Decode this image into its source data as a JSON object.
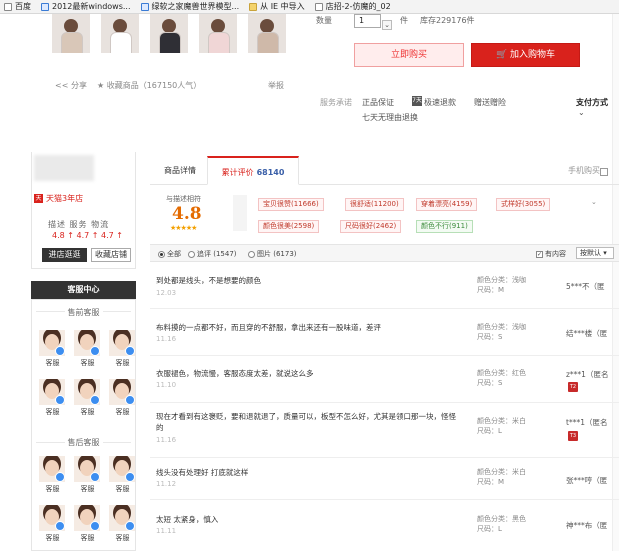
{
  "bookmarks": [
    {
      "label": "百度",
      "icon": "page-icon"
    },
    {
      "label": "2012最新windows...",
      "icon": "ie-icon"
    },
    {
      "label": "绿软之家魔兽世界模型...",
      "icon": "ie-icon"
    },
    {
      "label": "从 IE 中导入",
      "icon": "folder-icon"
    },
    {
      "label": "店招-2-仿魔的_02",
      "icon": "page-icon"
    }
  ],
  "purchase": {
    "qty_label": "数量",
    "qty_value": "1",
    "qty_unit": "件",
    "stock": "库存229176件",
    "buy_now": "立即购买",
    "add_to_cart": "加入购物车"
  },
  "actions": {
    "share": "分享",
    "favorite": "收藏商品（167150人气）",
    "report": "举报"
  },
  "services": {
    "label": "服务承诺",
    "item1": "正品保证",
    "item2_icon_text": "7天",
    "item2": "极速退款",
    "item3": "赠送赠险",
    "item4": "七天无理由退换",
    "payment_label": "支付方式",
    "payment_chevron": "⌄"
  },
  "shop": {
    "level_icon": "天",
    "level": "天猫3年店",
    "dsr_head": "描述 服务 物流",
    "dsr_values": "4.8 ↑   4.7 ↑   4.7 ↑",
    "enter_shop": "进店逛逛",
    "save_shop": "收藏店铺"
  },
  "customer_service": {
    "title": "客服中心",
    "presale_title": "售前客服",
    "aftersale_title": "售后客服",
    "agent_label": "客服"
  },
  "tabs": {
    "detail": "商品详情",
    "reviews": "累计评价",
    "reviews_count": "68140",
    "mobile": "手机购买"
  },
  "rating": {
    "label": "与描述相符",
    "score": "4.8",
    "stars": "★★★★★",
    "star_rating": 4.8
  },
  "tags": [
    {
      "text": "宝贝很赞(11666)",
      "type": "pos"
    },
    {
      "text": "很舒适(11200)",
      "type": "pos"
    },
    {
      "text": "穿着漂亮(4159)",
      "type": "pos"
    },
    {
      "text": "式样好(3055)",
      "type": "pos"
    },
    {
      "text": "颜色很美(2598)",
      "type": "pos"
    },
    {
      "text": "尺码很好(2462)",
      "type": "pos"
    },
    {
      "text": "颜色不行(911)",
      "type": "neg"
    }
  ],
  "tags_toggle": "⌄",
  "filters": {
    "all": "全部",
    "append": "追评 (1547)",
    "images": "图片 (6173)",
    "has_content": "有内容",
    "sort": "按默认 ▾"
  },
  "reviews": [
    {
      "text": "到处都是线头，不是想要的颜色",
      "date": "12.03",
      "color": "颜色分类：浅咖",
      "size": "尺码：M",
      "user": "5***不（匿",
      "badge": ""
    },
    {
      "text": "布料摸的一点都不好，而且穿的不舒服，拿出来还有一股味道，差评",
      "date": "11.16",
      "color": "颜色分类：浅咖",
      "size": "尺码：S",
      "user": "结***楼（匿",
      "badge": ""
    },
    {
      "text": "衣服褪色，物流慢，客服态度太差，就说这么多",
      "date": "11.10",
      "color": "颜色分类：红色",
      "size": "尺码：S",
      "user": "z***1（匿名",
      "badge": "T2"
    },
    {
      "text": "现在才看到有这褒贬，要和退就退了，质量可以，板型不怎么好，尤其是领口那一块，怪怪的",
      "date": "11.16",
      "color": "颜色分类：米白",
      "size": "尺码：L",
      "user": "t***1（匿名",
      "badge": "T3"
    },
    {
      "text": "线头没有处理好 打底就这样",
      "date": "11.12",
      "color": "颜色分类：米白",
      "size": "尺码：M",
      "user": "张***哼（匿",
      "badge": ""
    },
    {
      "text": "太短 太紧身，慎入",
      "date": "11.11",
      "color": "颜色分类：黑色",
      "size": "尺码：L",
      "user": "神***布（匿",
      "badge": ""
    }
  ]
}
